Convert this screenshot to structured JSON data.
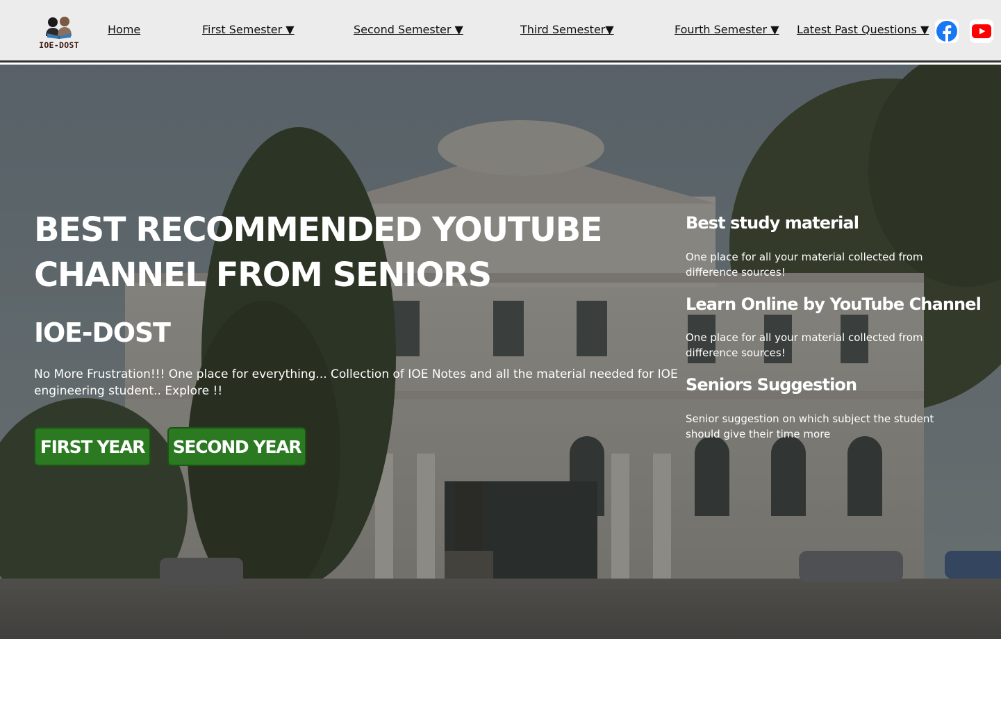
{
  "logo": {
    "text": "IOE-DOST"
  },
  "nav": {
    "home": "Home",
    "first_semester": "First Semester ▼",
    "second_semester": "Second Semester ▼",
    "third_semester": "Third Semester▼",
    "fourth_semester": "Fourth Semester ▼",
    "latest_past_questions": "Latest Past Questions ▼"
  },
  "social": {
    "facebook_icon": "facebook-icon",
    "youtube_icon": "youtube-icon",
    "facebook_color": "#1877f2",
    "youtube_color": "#ff0000"
  },
  "hero": {
    "title_line1": "BEST RECOMMENDED YOUTUBE",
    "title_line2": "CHANNEL FROM SENIORS",
    "brand": "IOE-DOST",
    "description": "No More Frustration!!! One place for everything... Collection of IOE Notes and all the material needed for IOE engineering student.. Explore !!",
    "buttons": {
      "first_year": "FIRST YEAR",
      "second_year": "SECOND YEAR"
    },
    "button_color": "#2b7a22"
  },
  "features": [
    {
      "heading": "Best study material",
      "text": "One place for all your material collected from difference sources!"
    },
    {
      "heading": "Learn Online by YouTube Channel",
      "text": "One place for all your material collected from difference sources!"
    },
    {
      "heading": "Seniors Suggestion",
      "text": "Senior suggestion on which subject the student should give their time more"
    }
  ]
}
